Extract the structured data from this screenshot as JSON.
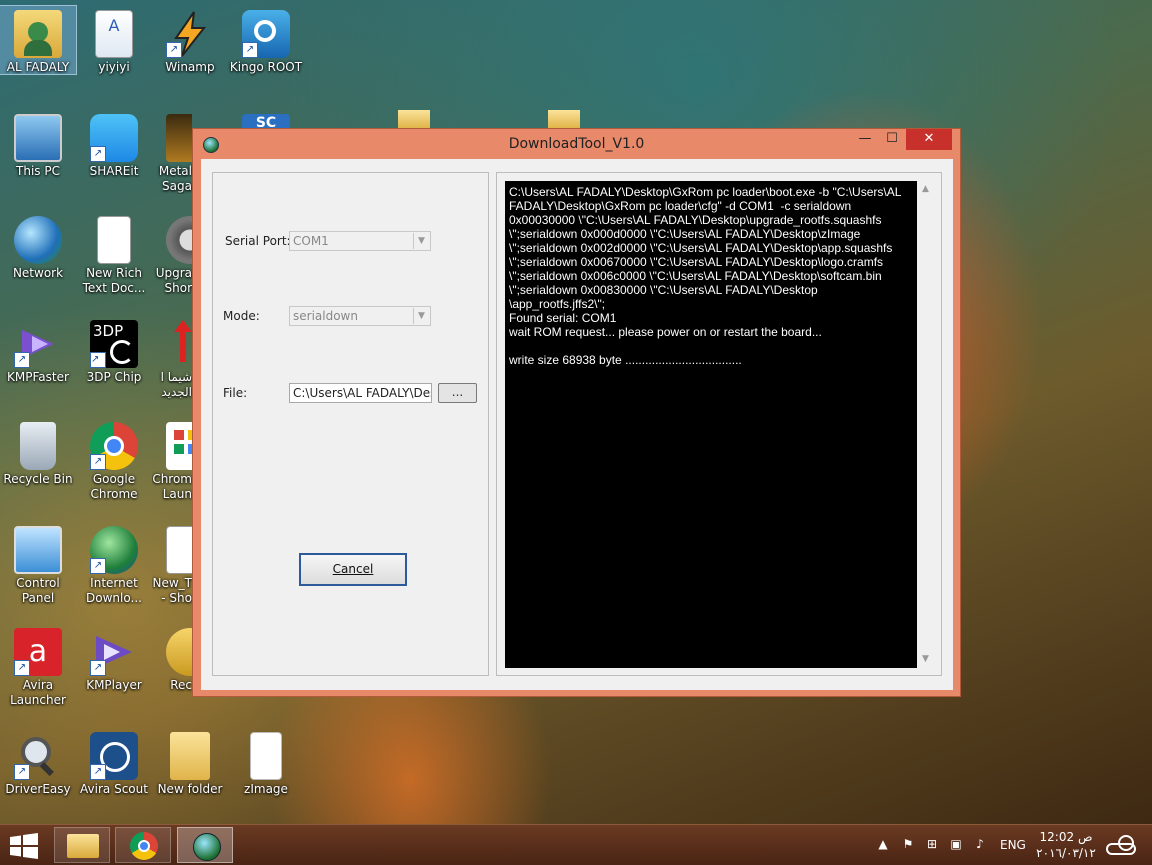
{
  "desktop": {
    "icons": [
      {
        "label": "AL FADALY",
        "label2": ""
      },
      {
        "label": "yiyiyi",
        "label2": ""
      },
      {
        "label": "Winamp",
        "label2": ""
      },
      {
        "label": "Kingo ROOT",
        "label2": ""
      },
      {
        "label": "This PC",
        "label2": ""
      },
      {
        "label": "SHAREit",
        "label2": ""
      },
      {
        "label": "Metal",
        "label2": "Saga"
      },
      {
        "label": "Network",
        "label2": ""
      },
      {
        "label": "New Rich",
        "label2": "Text Doc..."
      },
      {
        "label": "Upgra",
        "label2": "Shor"
      },
      {
        "label": "KMPFaster",
        "label2": ""
      },
      {
        "label": "3DP Chip",
        "label2": ""
      },
      {
        "label": "شيما ا",
        "label2": "الجديد"
      },
      {
        "label": "Recycle Bin",
        "label2": ""
      },
      {
        "label": "Google",
        "label2": "Chrome"
      },
      {
        "label": "Chrom",
        "label2": "Laun"
      },
      {
        "label": "Control Panel",
        "label2": ""
      },
      {
        "label": "Internet",
        "label2": "Downlo..."
      },
      {
        "label": "New_T",
        "label2": "- Sho"
      },
      {
        "label": "Avira",
        "label2": "Launcher"
      },
      {
        "label": "KMPlayer",
        "label2": ""
      },
      {
        "label": "Rec",
        "label2": ""
      },
      {
        "label": "DriverEasy",
        "label2": ""
      },
      {
        "label": "Avira Scout",
        "label2": ""
      },
      {
        "label": "New folder",
        "label2": ""
      },
      {
        "label": "zImage",
        "label2": ""
      },
      {
        "label": "3DP",
        "label2": ""
      },
      {
        "label": "SC",
        "label2": ""
      }
    ]
  },
  "window": {
    "title": "DownloadTool_V1.0",
    "min_glyph": "—",
    "max_glyph": "☐",
    "close_glyph": "✕",
    "serial_port_label": "Serial Port:",
    "serial_port_value": "COM1",
    "mode_label": "Mode:",
    "mode_value": "serialdown",
    "file_label": "File:",
    "file_value": "C:\\Users\\AL FADALY\\Desktop\\upgrade",
    "browse_label": "...",
    "cancel_label": "Cancel",
    "console_lines": [
      "C:\\Users\\AL FADALY\\Desktop\\GxRom pc loader\\boot.exe -b \"C:\\Users\\AL",
      "FADALY\\Desktop\\GxRom pc loader\\cfg\" -d COM1  -c serialdown",
      "0x00030000 \\\"C:\\Users\\AL FADALY\\Desktop\\upgrade_rootfs.squashfs",
      "\\\";serialdown 0x000d0000 \\\"C:\\Users\\AL FADALY\\Desktop\\zImage",
      "\\\";serialdown 0x002d0000 \\\"C:\\Users\\AL FADALY\\Desktop\\app.squashfs",
      "\\\";serialdown 0x00670000 \\\"C:\\Users\\AL FADALY\\Desktop\\logo.cramfs",
      "\\\";serialdown 0x006c0000 \\\"C:\\Users\\AL FADALY\\Desktop\\softcam.bin",
      "\\\";serialdown 0x00830000 \\\"C:\\Users\\AL FADALY\\Desktop",
      "\\app_rootfs.jffs2\\\";",
      "Found serial: COM1",
      "wait ROM request... please power on or restart the board...",
      "",
      "write size 68938 byte ..................................."
    ]
  },
  "taskbar": {
    "language": "ENG",
    "time": "12:02 ص",
    "date": "٢٠١٦/٠٣/١٢"
  }
}
